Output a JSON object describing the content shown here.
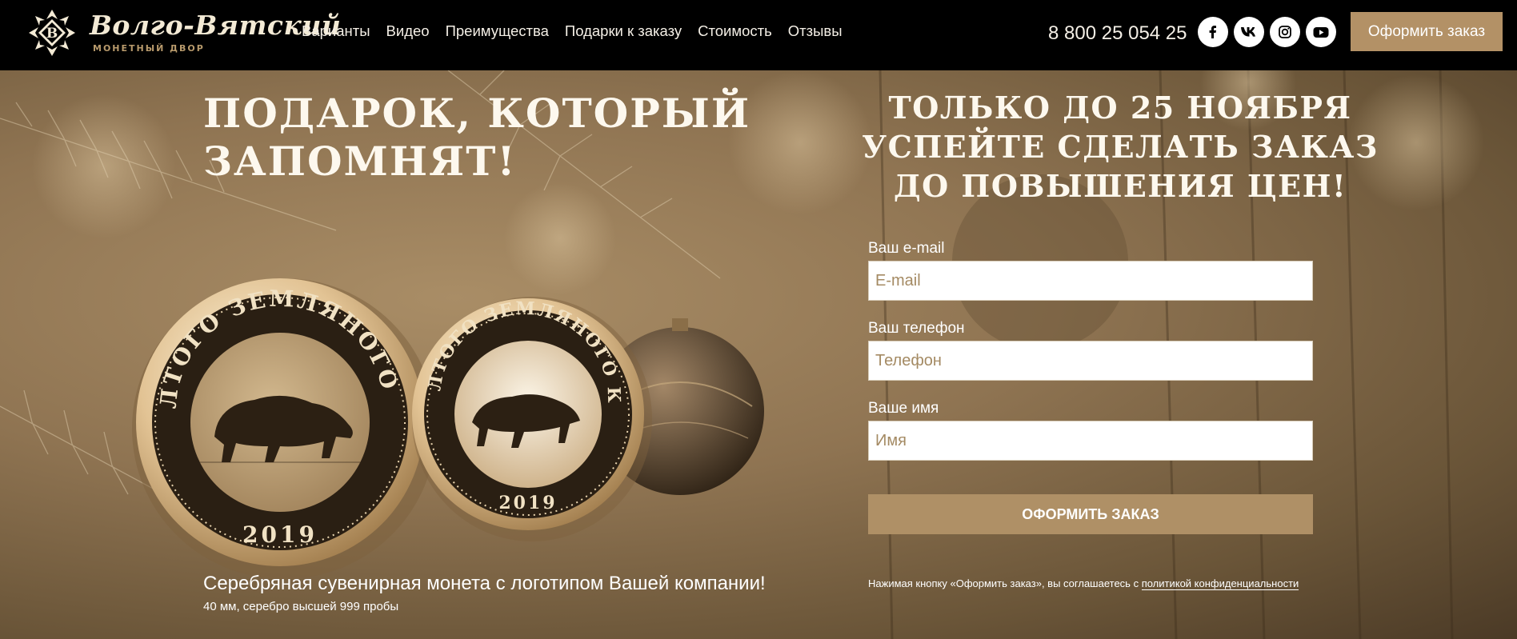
{
  "header": {
    "logo_title": "Волго-Вятский",
    "logo_subtitle": "МОНЕТНЫЙ ДВОР",
    "logo_letter": "В",
    "nav": [
      "Варианты",
      "Видео",
      "Преимущества",
      "Подарки к заказу",
      "Стоимость",
      "Отзывы"
    ],
    "phone": "8 800 25 054 25",
    "socials": [
      "facebook-icon",
      "vk-icon",
      "instagram-icon",
      "youtube-icon"
    ],
    "order_label": "Оформить заказ"
  },
  "hero": {
    "headline_line1": "ПОДАРОК, КОТОРЫЙ",
    "headline_line2": "ЗАПОМНЯТ!",
    "promo_line1": "ТОЛЬКО ДО 25 НОЯБРЯ",
    "promo_line2": "УСПЕЙТЕ СДЕЛАТЬ ЗАКАЗ",
    "promo_line3": "ДО ПОВЫШЕНИЯ ЦЕН!",
    "coin_text": "ГОД ЖЕЛТОГО ЗЕМЛЯНОГО КАБАНА",
    "coin_year": "2019",
    "caption": "Серебряная сувенирная монета с логотипом Вашей компании!",
    "caption_sub": "40 мм, серебро высшей 999 пробы"
  },
  "form": {
    "email_label": "Ваш e-mail",
    "email_placeholder": "E-mail",
    "phone_label": "Ваш телефон",
    "phone_placeholder": "Телефон",
    "name_label": "Ваше имя",
    "name_placeholder": "Имя",
    "submit_label": "ОФОРМИТЬ ЗАКАЗ",
    "agree_text": "Нажимая кнопку «Оформить заказ», вы соглашаетесь с ",
    "agree_link": "политикой конфиденциальности"
  },
  "colors": {
    "accent": "#b39166",
    "header_bg": "#000000",
    "hero_tone": "#8f7452"
  }
}
